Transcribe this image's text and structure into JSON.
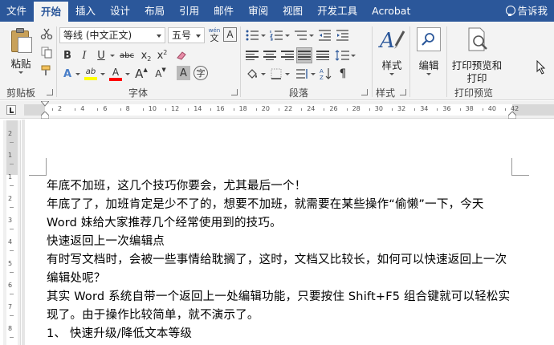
{
  "tabs": [
    "文件",
    "开始",
    "插入",
    "设计",
    "布局",
    "引用",
    "邮件",
    "审阅",
    "视图",
    "开发工具",
    "Acrobat"
  ],
  "active_tab": "开始",
  "tell_me": "告诉我",
  "clipboard": {
    "paste_label": "粘贴",
    "group_label": "剪贴板"
  },
  "font": {
    "name": "等线 (中文正文)",
    "size": "五号",
    "wen_label": "wén",
    "wen_char": "文",
    "format_a": "A",
    "bold": "B",
    "italic": "I",
    "underline": "U",
    "strike": "abc",
    "subscript": "x",
    "superscript": "x",
    "sub_digit": "2",
    "sup_digit": "2",
    "text_effects": "A",
    "highlight": "ab",
    "font_color": "A",
    "grow": "A",
    "shrink": "A",
    "char_shading": "A",
    "enclosed": "字",
    "group_label": "字体",
    "highlight_color": "#ffff00",
    "font_color_value": "#ff0000"
  },
  "paragraph": {
    "group_label": "段落"
  },
  "styles": {
    "label": "样式",
    "group_label": "样式"
  },
  "editing": {
    "label": "编辑"
  },
  "print": {
    "label": "打印预览和打印",
    "line1": "打印预览和",
    "line2": "打印",
    "group_label": "打印预览"
  },
  "ruler": {
    "h_numbers": [
      "2",
      "4",
      "6",
      "8",
      "10",
      "12",
      "14",
      "16",
      "18",
      "20",
      "22",
      "24",
      "26",
      "28",
      "30",
      "32",
      "34",
      "36",
      "38",
      "40",
      "42"
    ],
    "v_numbers": [
      "2",
      "1",
      "1",
      "2",
      "3",
      "4",
      "5",
      "6",
      "7",
      "8",
      "9"
    ]
  },
  "document": {
    "paragraphs": [
      "年底不加班，这几个技巧你要会，尤其最后一个！",
      "年底了了，加班肯定是少不了的，想要不加班，就需要在某些操作“偷懒”一下，今天 Word 妹给大家推荐几个经常使用到的技巧。",
      "快速返回上一次编辑点",
      "有时写文档时，会被一些事情给耽搁了，这时，文档又比较长，如何可以快速返回上一次编辑处呢？",
      "其实 Word 系统自带一个返回上一处编辑功能，只要按住 Shift+F5 组合键就可以轻松实现了。由于操作比较简单，就不演示了。",
      "1、 快速升级/降低文本等级"
    ]
  },
  "colors": {
    "title_bar": "#2b579a",
    "ribbon_bg": "#f3f3f3",
    "accent": "#2b579a"
  }
}
